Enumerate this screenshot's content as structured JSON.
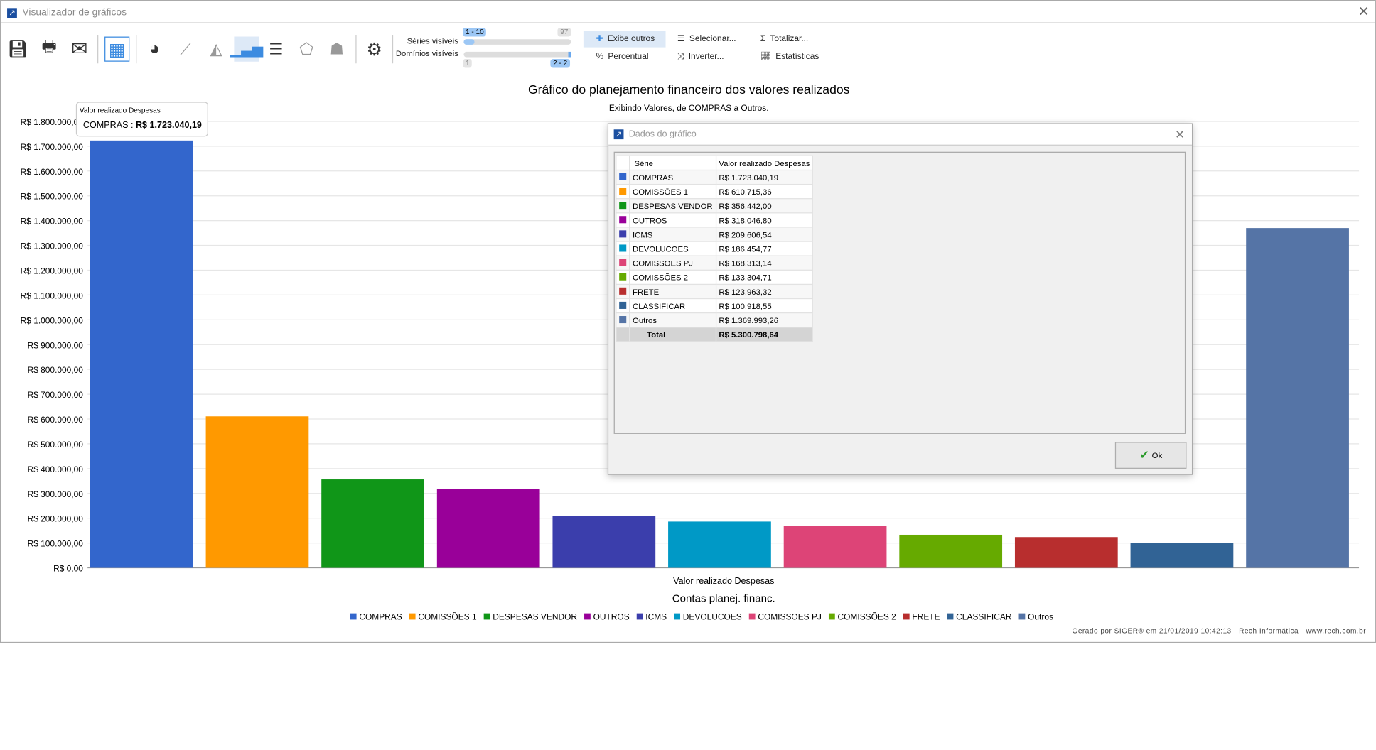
{
  "window": {
    "title": "Visualizador de gráficos",
    "close_icon": "close-icon"
  },
  "toolbar": {
    "icons": [
      "save-icon",
      "print-icon",
      "mail-icon",
      "table-icon",
      "pie-chart-icon",
      "line-chart-icon",
      "area-chart-icon",
      "bar-chart-icon",
      "horizontal-bar-icon",
      "radar-icon",
      "map-icon",
      "gear-icon"
    ],
    "series_label": "Séries visíveis",
    "series_range": "1 - 10",
    "series_max": "97",
    "series_fraction": 0.1,
    "domains_label": "Domínios visíveis",
    "domains_min": "1",
    "domains_range": "2 - 2",
    "exibe_outros": "Exibe outros",
    "percentual": "Percentual",
    "selecionar": "Selecionar...",
    "inverter": "Inverter...",
    "totalizar": "Totalizar...",
    "estatisticas": "Estatísticas"
  },
  "chart_data": {
    "type": "bar",
    "title": "Gráfico do planejamento financeiro dos valores realizados",
    "subtitle": "Exibindo Valores, de COMPRAS a Outros.",
    "xlabel": "Valor realizado Despesas",
    "domain_label": "Contas planej. financ.",
    "ylim": [
      0,
      1800000
    ],
    "yticks": [
      "R$ 0,00",
      "R$ 100.000,00",
      "R$ 200.000,00",
      "R$ 300.000,00",
      "R$ 400.000,00",
      "R$ 500.000,00",
      "R$ 600.000,00",
      "R$ 700.000,00",
      "R$ 800.000,00",
      "R$ 900.000,00",
      "R$ 1.000.000,00",
      "R$ 1.100.000,00",
      "R$ 1.200.000,00",
      "R$ 1.300.000,00",
      "R$ 1.400.000,00",
      "R$ 1.500.000,00",
      "R$ 1.600.000,00",
      "R$ 1.700.000,00",
      "R$ 1.800.000,00"
    ],
    "grid": true,
    "legend_position": "bottom",
    "series": [
      {
        "name": "COMPRAS",
        "value": 1723040.19,
        "label": "R$ 1.723.040,19",
        "color": "#3366cc"
      },
      {
        "name": "COMISSÕES 1",
        "value": 610715.36,
        "label": "R$ 610.715,36",
        "color": "#ff9900"
      },
      {
        "name": "DESPESAS VENDOR",
        "value": 356442.0,
        "label": "R$ 356.442,00",
        "color": "#109618"
      },
      {
        "name": "OUTROS",
        "value": 318046.8,
        "label": "R$ 318.046,80",
        "color": "#990099"
      },
      {
        "name": "ICMS",
        "value": 209606.54,
        "label": "R$ 209.606,54",
        "color": "#3b3eac"
      },
      {
        "name": "DEVOLUCOES",
        "value": 186454.77,
        "label": "R$ 186.454,77",
        "color": "#0099c6"
      },
      {
        "name": "COMISSOES PJ",
        "value": 168313.14,
        "label": "R$ 168.313,14",
        "color": "#dd4477"
      },
      {
        "name": "COMISSÕES 2",
        "value": 133304.71,
        "label": "R$ 133.304,71",
        "color": "#66aa00"
      },
      {
        "name": "FRETE",
        "value": 123963.32,
        "label": "R$ 123.963,32",
        "color": "#b82e2e"
      },
      {
        "name": "CLASSIFICAR",
        "value": 100918.55,
        "label": "R$ 100.918,55",
        "color": "#316395"
      },
      {
        "name": "Outros",
        "value": 1369993.26,
        "label": "R$ 1.369.993,26",
        "color": "#5574a6"
      }
    ]
  },
  "tooltip": {
    "title": "Valor realizado Despesas",
    "series": "COMPRAS",
    "sep": ":",
    "value": "R$ 1.723.040,19"
  },
  "footer": "Gerado por SIGER® em 21/01/2019 10:42:13 - Rech Informática - www.rech.com.br",
  "dialog": {
    "title": "Dados do gráfico",
    "col_serie": "Série",
    "col_valor": "Valor realizado Despesas",
    "total_label": "Total",
    "total_value": "R$ 5.300.798,64",
    "ok": "Ok"
  }
}
